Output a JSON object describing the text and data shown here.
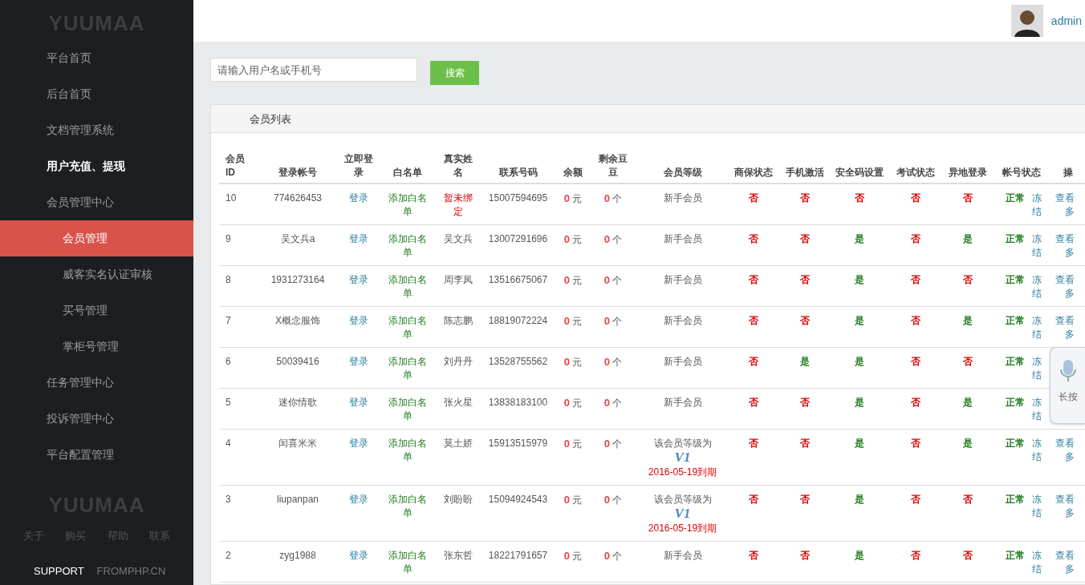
{
  "sidebar": {
    "logo": "YUUMAA",
    "items": [
      {
        "label": "平台首页",
        "selected": false,
        "emphasized": false
      },
      {
        "label": "后台首页",
        "selected": false,
        "emphasized": false
      },
      {
        "label": "文档管理系统",
        "selected": false,
        "emphasized": false
      },
      {
        "label": "用户充值、提现",
        "selected": false,
        "emphasized": true
      },
      {
        "label": "会员管理中心",
        "selected": false,
        "emphasized": false,
        "expanded": true,
        "children": [
          {
            "label": "会员管理",
            "selected": true,
            "emphasized": false
          },
          {
            "label": "威客实名认证审核",
            "selected": false,
            "emphasized": false
          },
          {
            "label": "买号管理",
            "selected": false,
            "emphasized": false
          },
          {
            "label": "掌柜号管理",
            "selected": false,
            "emphasized": false
          }
        ]
      },
      {
        "label": "任务管理中心",
        "selected": false,
        "emphasized": false
      },
      {
        "label": "投诉管理中心",
        "selected": false,
        "emphasized": false
      },
      {
        "label": "平台配置管理",
        "selected": false,
        "emphasized": false
      }
    ],
    "footer_logo": "YUUMAA",
    "footer_links": [
      "关于",
      "购买",
      "帮助",
      "联系"
    ],
    "support": "SUPPORT",
    "site": "FROMPHP.CN"
  },
  "header": {
    "user": "admin"
  },
  "search": {
    "placeholder": "请输入用户名或手机号",
    "button": "搜索"
  },
  "panel": {
    "title": "会员列表"
  },
  "table": {
    "columns": [
      "会员ID",
      "登录帐号",
      "立即登录",
      "白名单",
      "真实姓名",
      "联系号码",
      "余额",
      "剩余豆豆",
      "会员等级",
      "商保状态",
      "手机激活",
      "安全码设置",
      "考试状态",
      "异地登录",
      "帐号状态",
      "操"
    ],
    "rows": [
      {
        "id": "10",
        "account": "774626453",
        "login": "登录",
        "whitelist": "添加白名单",
        "name": {
          "text": "暂未绑定",
          "warn": true
        },
        "phone": "15007594695",
        "balance": "0",
        "balance_unit": "元",
        "beans": "0",
        "beans_unit": "个",
        "level": {
          "kind": "plain",
          "text": "新手会员"
        },
        "flags": [
          {
            "text": "否",
            "on": false
          },
          {
            "text": "否",
            "on": false
          },
          {
            "text": "否",
            "on": false
          },
          {
            "text": "否",
            "on": false
          },
          {
            "text": "否",
            "on": false
          }
        ],
        "status": "正常",
        "freeze": "冻结",
        "op": [
          "查看",
          "多"
        ]
      },
      {
        "id": "9",
        "account": "吴文兵a",
        "login": "登录",
        "whitelist": "添加白名单",
        "name": {
          "text": "吴文兵",
          "warn": false
        },
        "phone": "13007291696",
        "balance": "0",
        "balance_unit": "元",
        "beans": "0",
        "beans_unit": "个",
        "level": {
          "kind": "plain",
          "text": "新手会员"
        },
        "flags": [
          {
            "text": "否",
            "on": false
          },
          {
            "text": "否",
            "on": false
          },
          {
            "text": "是",
            "on": true
          },
          {
            "text": "否",
            "on": false
          },
          {
            "text": "是",
            "on": true
          }
        ],
        "status": "正常",
        "freeze": "冻结",
        "op": [
          "查看",
          "多"
        ]
      },
      {
        "id": "8",
        "account": "1931273164",
        "login": "登录",
        "whitelist": "添加白名单",
        "name": {
          "text": "周李凤",
          "warn": false
        },
        "phone": "13516675067",
        "balance": "0",
        "balance_unit": "元",
        "beans": "0",
        "beans_unit": "个",
        "level": {
          "kind": "plain",
          "text": "新手会员"
        },
        "flags": [
          {
            "text": "否",
            "on": false
          },
          {
            "text": "否",
            "on": false
          },
          {
            "text": "是",
            "on": true
          },
          {
            "text": "否",
            "on": false
          },
          {
            "text": "否",
            "on": false
          }
        ],
        "status": "正常",
        "freeze": "冻结",
        "op": [
          "查看",
          "多"
        ]
      },
      {
        "id": "7",
        "account": "X概念服饰",
        "login": "登录",
        "whitelist": "添加白名单",
        "name": {
          "text": "陈志鹏",
          "warn": false
        },
        "phone": "18819072224",
        "balance": "0",
        "balance_unit": "元",
        "beans": "0",
        "beans_unit": "个",
        "level": {
          "kind": "plain",
          "text": "新手会员"
        },
        "flags": [
          {
            "text": "否",
            "on": false
          },
          {
            "text": "否",
            "on": false
          },
          {
            "text": "是",
            "on": true
          },
          {
            "text": "否",
            "on": false
          },
          {
            "text": "是",
            "on": true
          }
        ],
        "status": "正常",
        "freeze": "冻结",
        "op": [
          "查看",
          "多"
        ]
      },
      {
        "id": "6",
        "account": "50039416",
        "login": "登录",
        "whitelist": "添加白名单",
        "name": {
          "text": "刘丹丹",
          "warn": false
        },
        "phone": "13528755562",
        "balance": "0",
        "balance_unit": "元",
        "beans": "0",
        "beans_unit": "个",
        "level": {
          "kind": "plain",
          "text": "新手会员"
        },
        "flags": [
          {
            "text": "否",
            "on": false
          },
          {
            "text": "是",
            "on": true
          },
          {
            "text": "是",
            "on": true
          },
          {
            "text": "否",
            "on": false
          },
          {
            "text": "否",
            "on": false
          }
        ],
        "status": "正常",
        "freeze": "冻结"
      },
      {
        "id": "5",
        "account": "迷你情歌",
        "login": "登录",
        "whitelist": "添加白名单",
        "name": {
          "text": "张火星",
          "warn": false
        },
        "phone": "13838183100",
        "balance": "0",
        "balance_unit": "元",
        "beans": "0",
        "beans_unit": "个",
        "level": {
          "kind": "plain",
          "text": "新手会员"
        },
        "flags": [
          {
            "text": "否",
            "on": false
          },
          {
            "text": "否",
            "on": false
          },
          {
            "text": "是",
            "on": true
          },
          {
            "text": "否",
            "on": false
          },
          {
            "text": "是",
            "on": true
          }
        ],
        "status": "正常",
        "freeze": "冻结"
      },
      {
        "id": "4",
        "account": "闰喜米米",
        "login": "登录",
        "whitelist": "添加白名单",
        "name": {
          "text": "莫土娇",
          "warn": false
        },
        "phone": "15913515979",
        "balance": "0",
        "balance_unit": "元",
        "beans": "0",
        "beans_unit": "个",
        "level": {
          "kind": "vip",
          "text": "该会员等级为",
          "badge": "V1",
          "expiry": "2016-05-19到期"
        },
        "flags": [
          {
            "text": "否",
            "on": false
          },
          {
            "text": "否",
            "on": false
          },
          {
            "text": "是",
            "on": true
          },
          {
            "text": "否",
            "on": false
          },
          {
            "text": "是",
            "on": true
          }
        ],
        "status": "正常",
        "freeze": "冻结",
        "op": [
          "查看",
          "多"
        ]
      },
      {
        "id": "3",
        "account": "liupanpan",
        "login": "登录",
        "whitelist": "添加白名单",
        "name": {
          "text": "刘盼盼",
          "warn": false
        },
        "phone": "15094924543",
        "balance": "0",
        "balance_unit": "元",
        "beans": "0",
        "beans_unit": "个",
        "level": {
          "kind": "vip",
          "text": "该会员等级为",
          "badge": "V1",
          "expiry": "2016-05-19到期"
        },
        "flags": [
          {
            "text": "否",
            "on": false
          },
          {
            "text": "否",
            "on": false
          },
          {
            "text": "是",
            "on": true
          },
          {
            "text": "否",
            "on": false
          },
          {
            "text": "否",
            "on": false
          }
        ],
        "status": "正常",
        "freeze": "冻结",
        "op": [
          "查看",
          "多"
        ]
      },
      {
        "id": "2",
        "account": "zyg1988",
        "login": "登录",
        "whitelist": "添加白名单",
        "name": {
          "text": "张东哲",
          "warn": false
        },
        "phone": "18221791657",
        "balance": "0",
        "balance_unit": "元",
        "beans": "0",
        "beans_unit": "个",
        "level": {
          "kind": "plain",
          "text": "新手会员"
        },
        "flags": [
          {
            "text": "否",
            "on": false
          },
          {
            "text": "否",
            "on": false
          },
          {
            "text": "是",
            "on": true
          },
          {
            "text": "否",
            "on": false
          },
          {
            "text": "否",
            "on": false
          }
        ],
        "status": "正常",
        "freeze": "冻结",
        "op": [
          "查看",
          "多"
        ]
      }
    ]
  },
  "voice_widget": {
    "label": "长按"
  }
}
